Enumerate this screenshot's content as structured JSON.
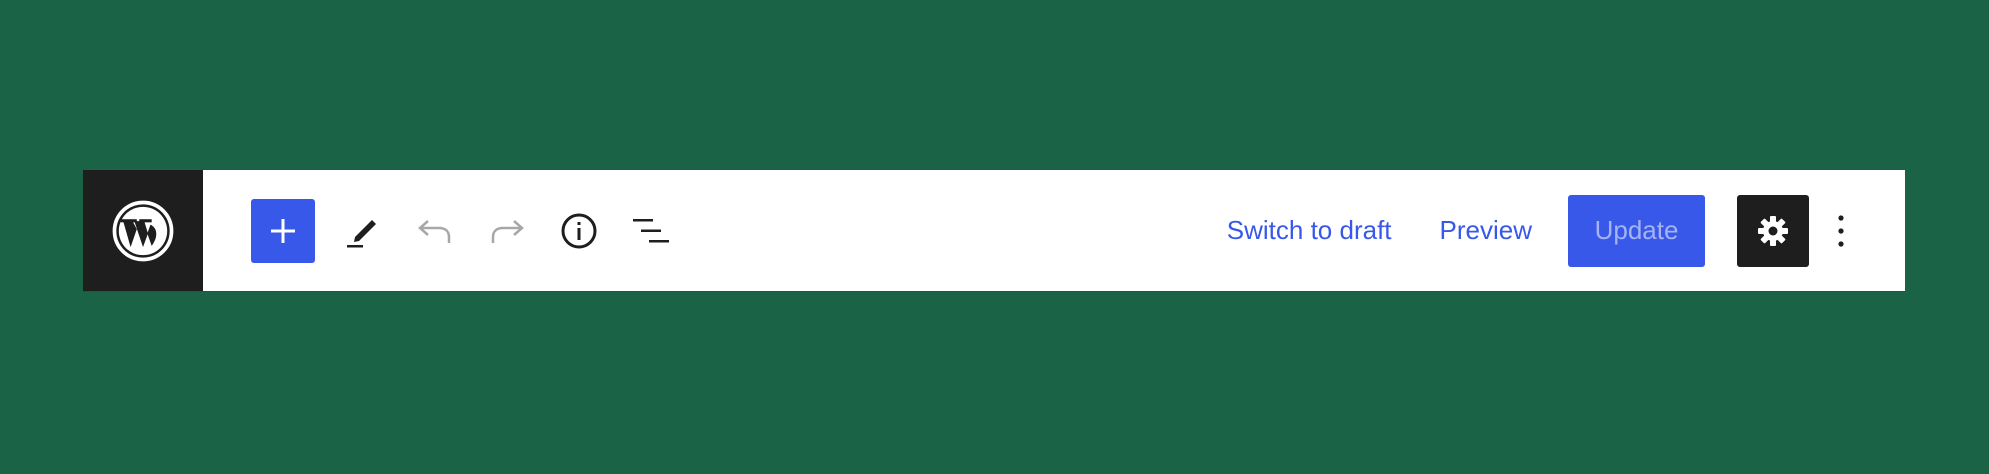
{
  "colors": {
    "background": "#1b6346",
    "toolbar": "#ffffff",
    "logo_bg": "#1e1e1e",
    "accent": "#3858e9",
    "disabled_icon": "#a7a7a7",
    "update_text": "#a5b3f3"
  },
  "header": {
    "logo": {
      "icon": "wordpress-logo-icon"
    },
    "left_tools": [
      {
        "icon": "plus-icon",
        "enabled": true
      },
      {
        "icon": "pencil-icon",
        "enabled": true
      },
      {
        "icon": "undo-icon",
        "enabled": false
      },
      {
        "icon": "redo-icon",
        "enabled": false
      },
      {
        "icon": "info-icon",
        "enabled": true
      },
      {
        "icon": "list-view-icon",
        "enabled": true
      }
    ],
    "switch_to_draft_label": "Switch to draft",
    "preview_label": "Preview",
    "update_label": "Update",
    "settings_icon": "gear-icon",
    "more_icon": "more-vertical-icon"
  }
}
